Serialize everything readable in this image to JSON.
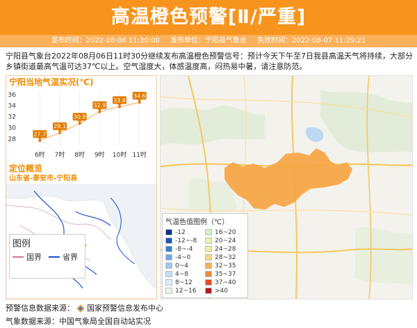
{
  "header": {
    "title": "高温橙色预警[Ⅱ/严重]",
    "issue_time": "发布时间：2022-08-06 11:30:00",
    "issuer": "发布单位：宁阳县气象台",
    "expire_time": "失效时间：2022-08-07 11:29:21"
  },
  "description": "宁阳县气象台2022年08月06日11时30分继续发布高温橙色预警信号：预计今天下午至7日我县高温天气将持续，大部分乡镇街道最高气温可达37℃以上。空气湿度大，体感温度高，闷热易中暑，请注意防范。",
  "temp_section": {
    "title": "宁阳当地气温实况(℃)"
  },
  "chart_data": {
    "type": "line",
    "categories": [
      "6时",
      "7时",
      "8时",
      "9时",
      "10时",
      "11时"
    ],
    "values": [
      27.7,
      29.1,
      30.8,
      32.9,
      33.8,
      34.6
    ],
    "value_labels": [
      "27.7",
      "29.1",
      "30.8",
      "32.9",
      "33.8",
      "34.6"
    ],
    "y_ticks": [
      "28",
      "30",
      "32",
      "34",
      "36"
    ],
    "ylim": [
      26.8,
      36.6
    ],
    "line_color": "#f6c69a",
    "label_color": "#e07b00"
  },
  "location": {
    "title": "定位概览",
    "name": "山东省-泰安市-宁阳县"
  },
  "mini_legend": {
    "title": "图例",
    "national_border": "国界",
    "provincial_border": "省界"
  },
  "map_legend": {
    "title": "气温色值图例（℃）",
    "items": [
      {
        "label": "-12",
        "color": "#0d2f8f"
      },
      {
        "label": "16~20",
        "color": "#d4f1c4"
      },
      {
        "label": "-12~-8",
        "color": "#1e54b5"
      },
      {
        "label": "20~24",
        "color": "#e6f4a6"
      },
      {
        "label": "-8~-4",
        "color": "#3b7dd0"
      },
      {
        "label": "24~28",
        "color": "#f5ee9c"
      },
      {
        "label": "-4~0",
        "color": "#6aa9e4"
      },
      {
        "label": "28~32",
        "color": "#f9d58a"
      },
      {
        "label": "0~4",
        "color": "#9cc9ef"
      },
      {
        "label": "32~35",
        "color": "#f6ac5b"
      },
      {
        "label": "4~8",
        "color": "#c1ddf3"
      },
      {
        "label": "35~37",
        "color": "#f08a38"
      },
      {
        "label": "8~12",
        "color": "#dbeef6"
      },
      {
        "label": "37~40",
        "color": "#e44a1f"
      },
      {
        "label": "12~16",
        "color": "#e7f5e7"
      },
      {
        "label": ">40",
        "color": "#b3161b"
      }
    ]
  },
  "footer": {
    "warning_source_label": "预警信息数据来源：",
    "warning_source": "国家预警信息发布中心",
    "weather_source": "气象数据来源：中国气象局全国自动站实况"
  },
  "colors": {
    "accent": "#f7941d",
    "warning_area": "#f6a543",
    "national_border": "#c97a8a",
    "provincial_border": "#1a4fcf"
  }
}
